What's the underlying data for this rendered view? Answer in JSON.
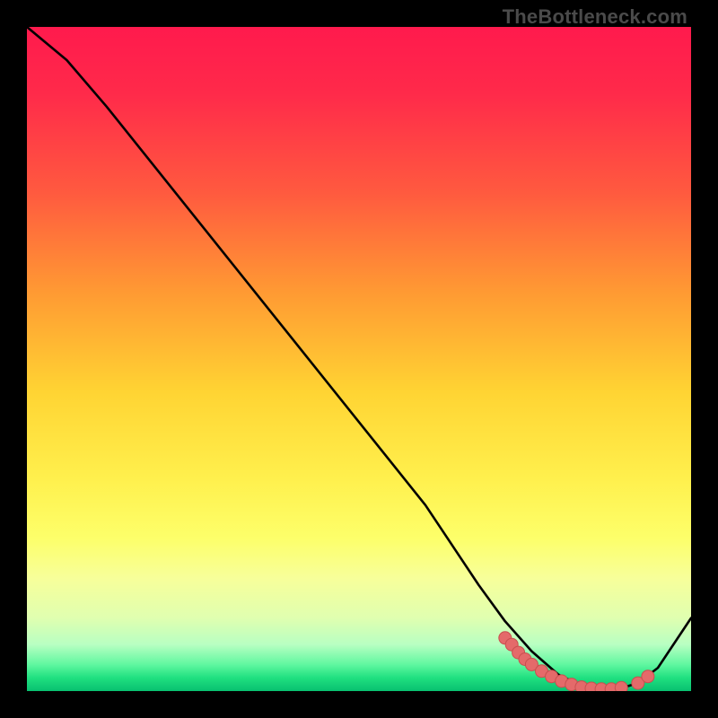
{
  "watermark": "TheBottleneck.com",
  "chart_data": {
    "type": "line",
    "title": "",
    "xlabel": "",
    "ylabel": "",
    "xlim": [
      0,
      100
    ],
    "ylim": [
      0,
      100
    ],
    "series": [
      {
        "name": "curve",
        "x": [
          0,
          6,
          12,
          18,
          24,
          30,
          36,
          42,
          48,
          54,
          60,
          64,
          68,
          72,
          76,
          80,
          83,
          86,
          89,
          92,
          95,
          100
        ],
        "y": [
          100,
          95,
          88,
          80.5,
          73,
          65.5,
          58,
          50.5,
          43,
          35.5,
          28,
          22,
          16,
          10.5,
          6,
          2.5,
          1,
          0.3,
          0.3,
          1.2,
          3.5,
          11
        ]
      }
    ],
    "markers": [
      {
        "x": 72.0,
        "y": 8.0
      },
      {
        "x": 73.0,
        "y": 7.0
      },
      {
        "x": 74.0,
        "y": 5.8
      },
      {
        "x": 75.0,
        "y": 4.8
      },
      {
        "x": 76.0,
        "y": 4.0
      },
      {
        "x": 77.5,
        "y": 3.0
      },
      {
        "x": 79.0,
        "y": 2.2
      },
      {
        "x": 80.5,
        "y": 1.5
      },
      {
        "x": 82.0,
        "y": 1.0
      },
      {
        "x": 83.5,
        "y": 0.6
      },
      {
        "x": 85.0,
        "y": 0.4
      },
      {
        "x": 86.5,
        "y": 0.3
      },
      {
        "x": 88.0,
        "y": 0.3
      },
      {
        "x": 89.5,
        "y": 0.5
      },
      {
        "x": 92.0,
        "y": 1.2
      },
      {
        "x": 93.5,
        "y": 2.2
      }
    ],
    "colors": {
      "line": "#000000",
      "marker_fill": "#e46a6a",
      "marker_stroke": "#c94f4f"
    }
  }
}
